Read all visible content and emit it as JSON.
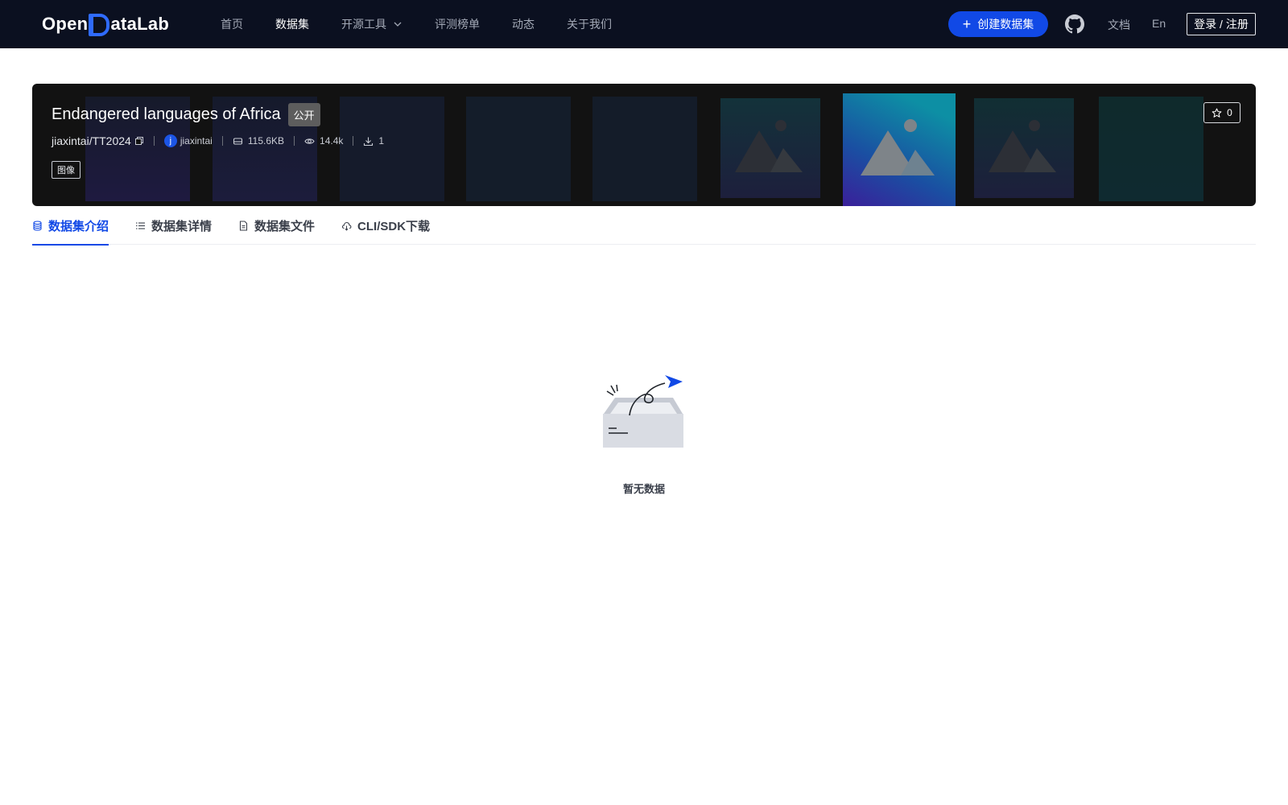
{
  "nav": {
    "logo": "OpenDataLab",
    "logo_left": "Open",
    "logo_right": "ataLab",
    "links": [
      {
        "label": "首页",
        "active": false
      },
      {
        "label": "数据集",
        "active": true
      },
      {
        "label": "开源工具",
        "active": false,
        "has_dropdown": true
      },
      {
        "label": "评测榜单",
        "active": false
      },
      {
        "label": "动态",
        "active": false
      },
      {
        "label": "关于我们",
        "active": false
      }
    ],
    "create_button": "创建数据集",
    "github_icon": "github-icon",
    "docs": "文档",
    "lang": "En",
    "login": "登录 / 注册"
  },
  "dataset": {
    "title": "Endangered languages of Africa",
    "visibility": "公开",
    "repo": "jiaxintai/TT2024",
    "owner_initial": "j",
    "owner": "jiaxintai",
    "size": "115.6KB",
    "views": "14.4k",
    "downloads": "1",
    "tag": "图像",
    "stars": "0"
  },
  "tabs": [
    {
      "label": "数据集介绍",
      "icon": "database-icon",
      "active": true
    },
    {
      "label": "数据集详情",
      "icon": "list-icon",
      "active": false
    },
    {
      "label": "数据集文件",
      "icon": "file-icon",
      "active": false
    },
    {
      "label": "CLI/SDK下载",
      "icon": "cloud-download-icon",
      "active": false
    }
  ],
  "empty": {
    "text": "暂无数据",
    "icon": "empty-box-icon"
  },
  "colors": {
    "nav_bg": "#0b1020",
    "accent": "#1149e6",
    "hero_bg": "#121212"
  }
}
